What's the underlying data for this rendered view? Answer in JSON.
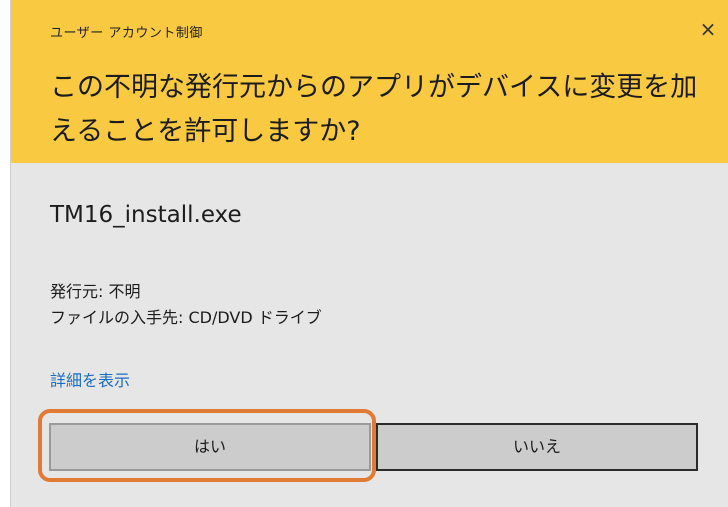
{
  "dialog": {
    "title": "ユーザー アカウント制御",
    "close_label": "×",
    "question": "この不明な発行元からのアプリがデバイスに変更を加えることを許可しますか?",
    "app_name": "TM16_install.exe",
    "publisher": "発行元: 不明",
    "origin": "ファイルの入手先: CD/DVD ドライブ",
    "details_link": "詳細を表示",
    "yes_label": "はい",
    "no_label": "いいえ"
  },
  "colors": {
    "header": "#f9c941",
    "body": "#e6e6e6",
    "link": "#1a6ec2",
    "highlight": "#e07a35"
  },
  "icons": {
    "close": "close-icon"
  }
}
